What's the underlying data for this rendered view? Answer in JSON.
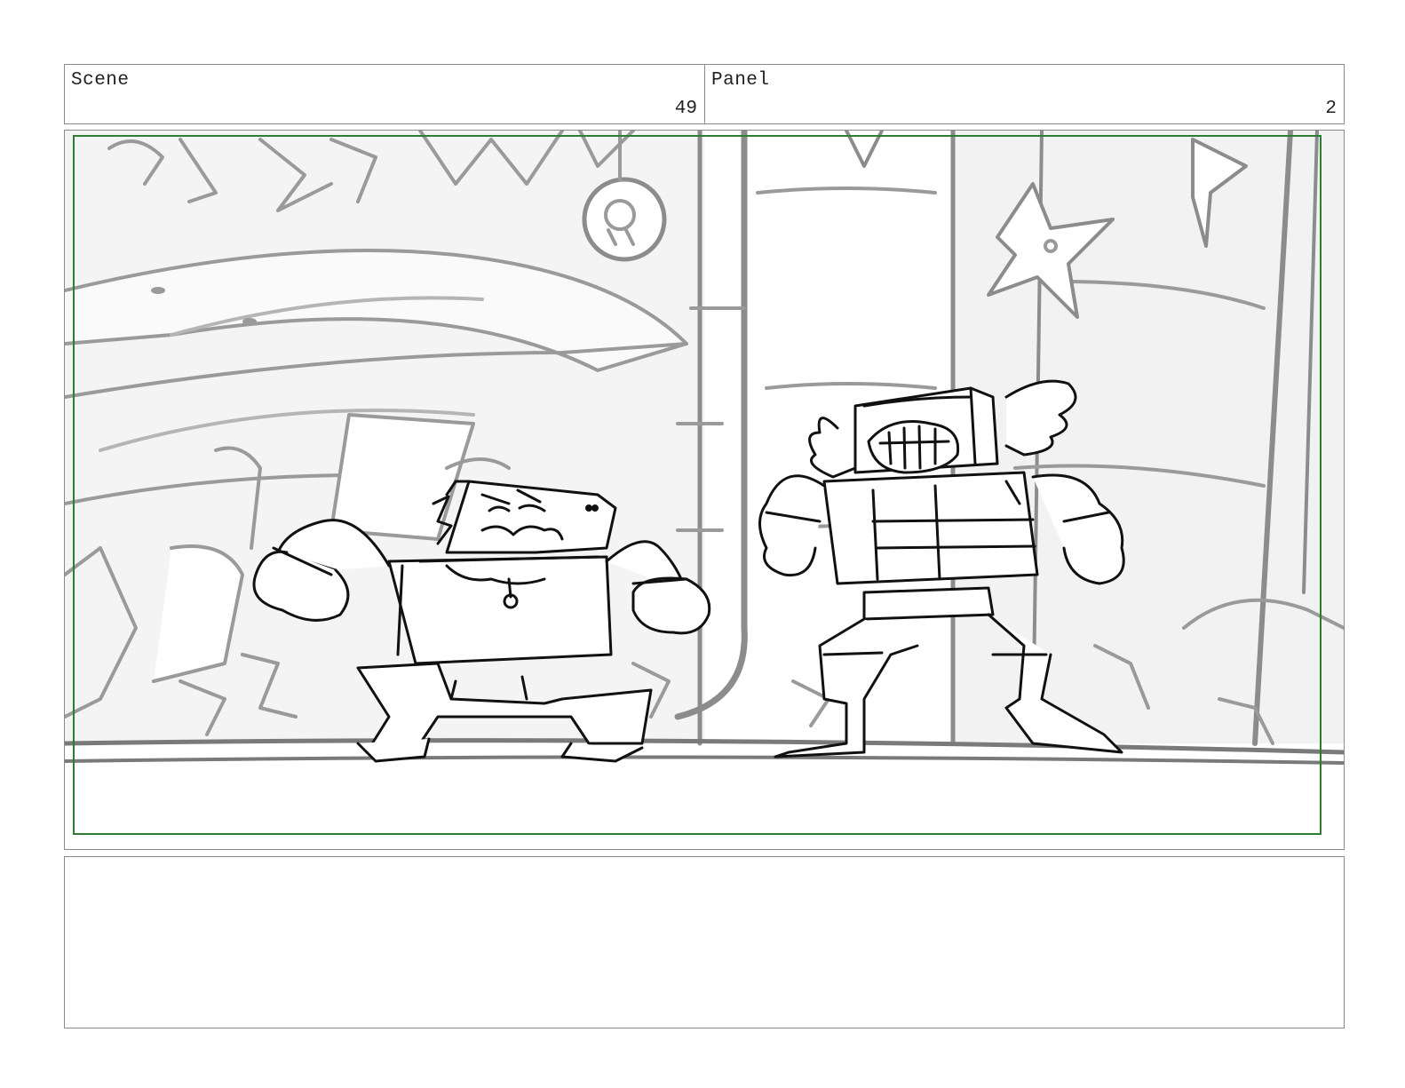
{
  "header": {
    "scene_label": "Scene",
    "scene_number": "49",
    "panel_label": "Panel",
    "panel_number": "2"
  },
  "artwork": {
    "safe_frame_color": "#2e7d32",
    "line_color": "#111111",
    "background_line_color": "#8c8c8c"
  },
  "notes": {
    "text": ""
  }
}
